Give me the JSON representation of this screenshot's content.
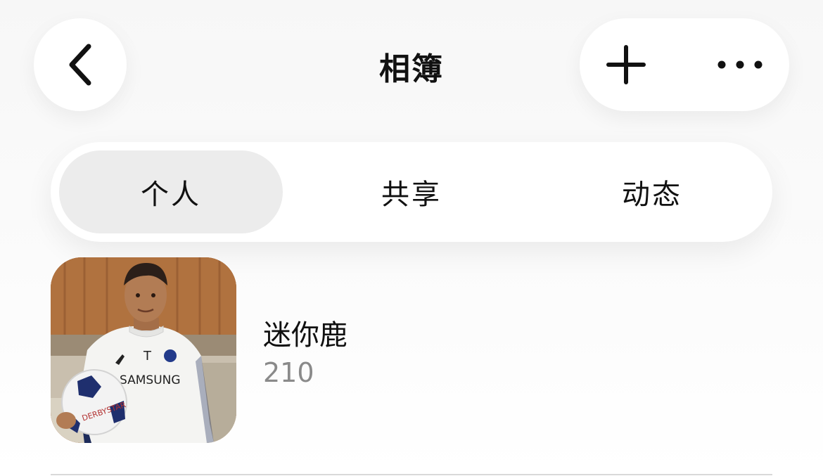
{
  "header": {
    "title": "相簿"
  },
  "tabs": [
    {
      "label": "个人",
      "active": true
    },
    {
      "label": "共享",
      "active": false
    },
    {
      "label": "动态",
      "active": false
    }
  ],
  "albums": [
    {
      "name": "迷你鹿",
      "count": "210"
    }
  ],
  "colors": {
    "active_tab_bg": "#ececec",
    "secondary_text": "#8a8a8a"
  }
}
